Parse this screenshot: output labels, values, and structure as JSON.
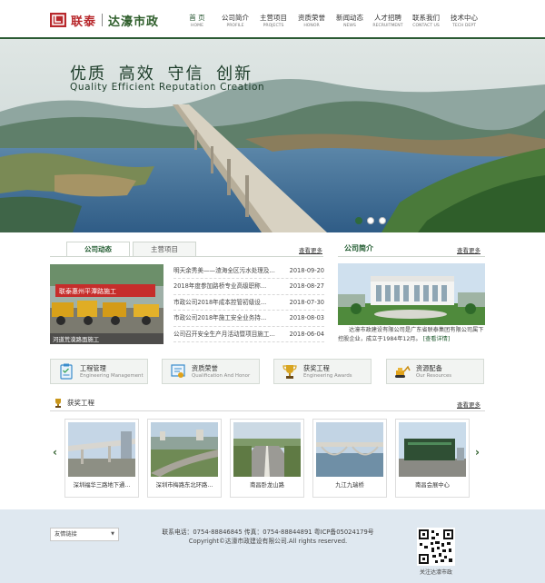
{
  "header": {
    "logo_name": "联泰",
    "logo_sub": "达濠市政",
    "nav": [
      {
        "zh": "首 页",
        "en": "HOME"
      },
      {
        "zh": "公司简介",
        "en": "PROFILE"
      },
      {
        "zh": "主营项目",
        "en": "PROJECTS"
      },
      {
        "zh": "资质荣誉",
        "en": "HONOR"
      },
      {
        "zh": "新闻动态",
        "en": "NEWS"
      },
      {
        "zh": "人才招聘",
        "en": "RECRUITMENT"
      },
      {
        "zh": "联系我们",
        "en": "CONTACT US"
      },
      {
        "zh": "技术中心",
        "en": "TECH DEPT"
      }
    ]
  },
  "banner": {
    "slogan_zh": "优质 高效 守信 创新",
    "slogan_en": "Quality Efficient Reputation Creation",
    "slide_count": 3,
    "active_slide": 1
  },
  "news": {
    "tabs": [
      "公司动态",
      "主营项目"
    ],
    "more": "查看更多",
    "image_caption": "河道荒漠路面施工",
    "items": [
      {
        "title": "明天余秀美——渣海全区污水处理及...",
        "date": "2018-09-20"
      },
      {
        "title": "2018年度参加路桥专业高级职称...",
        "date": "2018-08-27"
      },
      {
        "title": "市政公司2018年成本控管初级设...",
        "date": "2018-07-30"
      },
      {
        "title": "市政公司2018年施工安全业务持...",
        "date": "2018-08-03"
      },
      {
        "title": "公司召开安全生产月活动暨项目施工...",
        "date": "2018-06-04"
      }
    ]
  },
  "intro": {
    "title": "公司简介",
    "more": "查看更多",
    "text": "达濠市政建设有限公司是广东省联泰集团有限公司属下控股企业，成立于1984年12月。",
    "link": "[查看详情]"
  },
  "services": [
    {
      "zh": "工程管理",
      "en": "Engineering Management",
      "icon": "clipboard-icon",
      "color": "#3a8ccc"
    },
    {
      "zh": "资质荣誉",
      "en": "Qualification And Honor",
      "icon": "certificate-icon",
      "color": "#3a8ccc"
    },
    {
      "zh": "获奖工程",
      "en": "Engineering Awards",
      "icon": "trophy-icon",
      "color": "#c99a1c"
    },
    {
      "zh": "资源配备",
      "en": "Our Resources",
      "icon": "excavator-icon",
      "color": "#e0a21a"
    }
  ],
  "awards": {
    "title": "获奖工程",
    "more": "查看更多",
    "items": [
      "深圳福华三路地下通...",
      "深圳市梅路东北环路...",
      "南昌卧龙山路",
      "九江九瑞桥",
      "南昌会展中心"
    ]
  },
  "footer": {
    "select_label": "友情链接",
    "line1": "联系电话：0754-88846845 传真：0754-88844891 粤ICP备05024179号",
    "line2": "Copyright©达濠市政建设有限公司.All rights reserved.",
    "qr_caption": "关注达濠市政"
  },
  "colors": {
    "brand_red": "#b8282c",
    "brand_green": "#2e5e2b",
    "footer_bg": "#dfe8f0"
  }
}
